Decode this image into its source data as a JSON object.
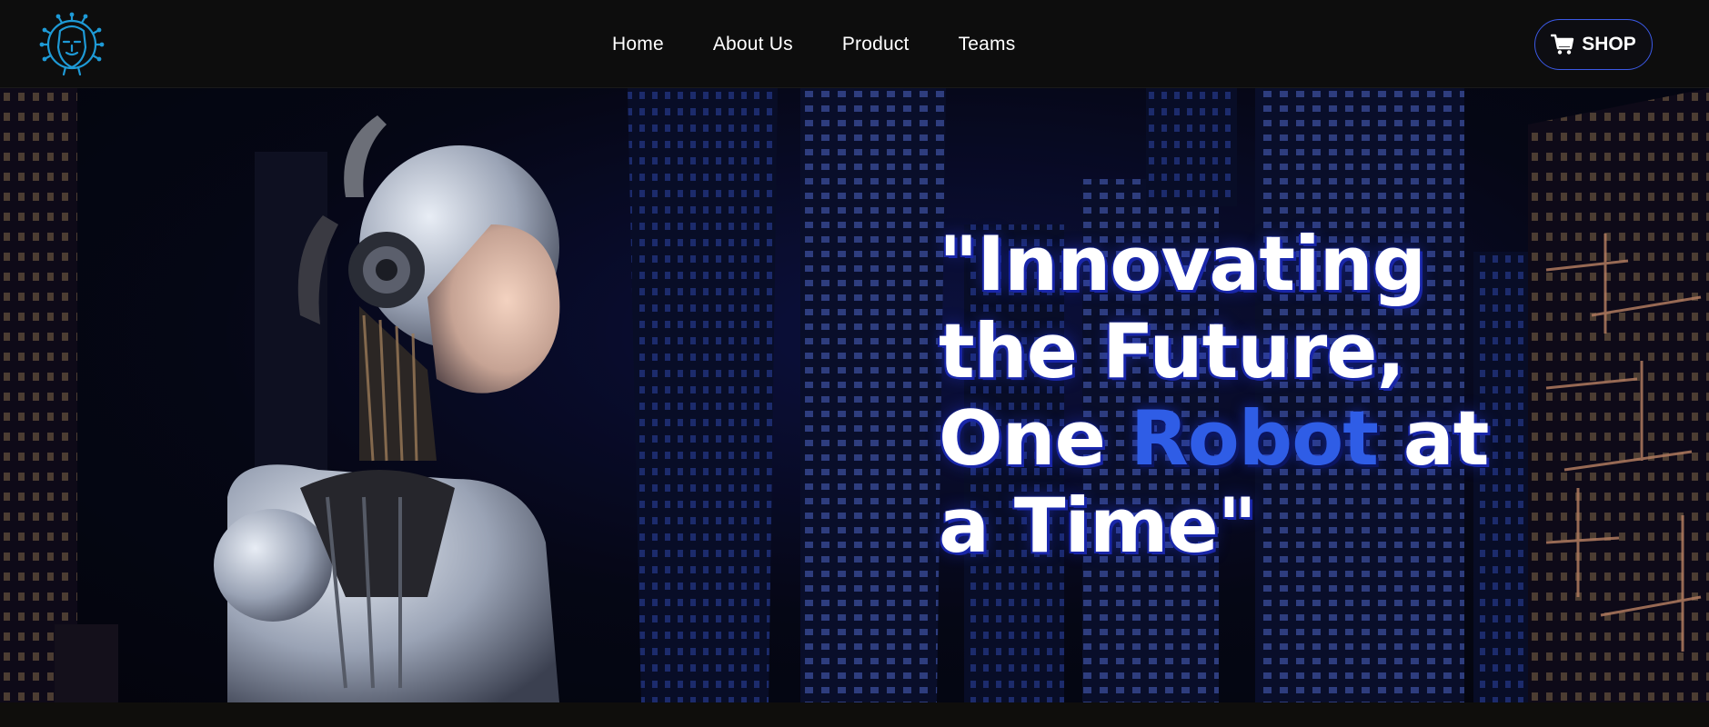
{
  "nav": {
    "logo": "robot-face-logo",
    "links": [
      {
        "label": "Home"
      },
      {
        "label": "About Us"
      },
      {
        "label": "Product"
      },
      {
        "label": "Teams"
      }
    ],
    "shop": {
      "label": "SHOP",
      "icon": "shopping-cart-icon"
    }
  },
  "hero": {
    "headline_before": "\"Innovating the Future, One ",
    "headline_accent": "Robot",
    "headline_after": " at a Time\""
  },
  "colors": {
    "accent": "#2f5de6",
    "logo": "#1e9ad6",
    "shop_border": "#3b59e6",
    "navbar_bg": "#0d0d0d"
  }
}
